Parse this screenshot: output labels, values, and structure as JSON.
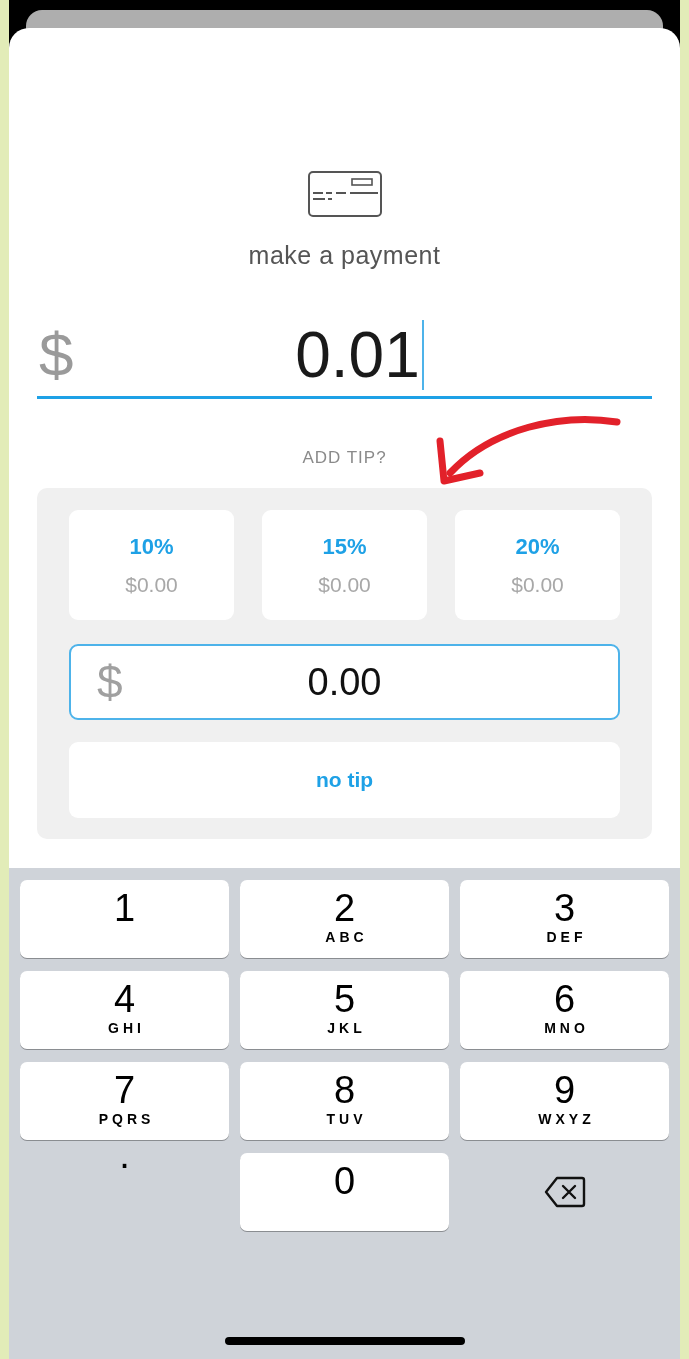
{
  "sheet": {
    "title": "make a payment",
    "amount": {
      "currency": "$",
      "value": "0.01",
      "cursor": true
    },
    "tip": {
      "label": "ADD TIP?",
      "options": [
        {
          "percent": "10%",
          "amount": "$0.00",
          "selected": false
        },
        {
          "percent": "15%",
          "amount": "$0.00",
          "selected": false
        },
        {
          "percent": "20%",
          "amount": "$0.00",
          "selected": false
        }
      ],
      "custom": {
        "currency": "$",
        "value": "0.00",
        "highlighted": true
      },
      "no_tip": "no tip"
    }
  },
  "keyboard": {
    "keys": [
      {
        "kind": "digit",
        "digit": "1"
      },
      {
        "kind": "digit",
        "digit": "2",
        "letters": "ABC"
      },
      {
        "kind": "digit",
        "digit": "3",
        "letters": "DEF"
      },
      {
        "kind": "digit",
        "digit": "4",
        "letters": "GHI"
      },
      {
        "kind": "digit",
        "digit": "5",
        "letters": "JKL"
      },
      {
        "kind": "digit",
        "digit": "6",
        "letters": "MNO"
      },
      {
        "kind": "digit",
        "digit": "7",
        "letters": "PQRS"
      },
      {
        "kind": "digit",
        "digit": "8",
        "letters": "TUV"
      },
      {
        "kind": "digit",
        "digit": "9",
        "letters": "WXYZ"
      },
      {
        "kind": "symbol",
        "digit": "."
      },
      {
        "kind": "digit",
        "digit": "0"
      },
      {
        "kind": "delete"
      }
    ]
  }
}
